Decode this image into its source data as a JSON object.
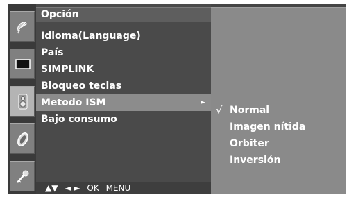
{
  "menu": {
    "title": "Opción",
    "items": [
      {
        "label": "Idioma(Language)",
        "selected": false
      },
      {
        "label": "País",
        "selected": false
      },
      {
        "label": "SIMPLINK",
        "selected": false
      },
      {
        "label": "Bloqueo teclas",
        "selected": false
      },
      {
        "label": "Metodo ISM",
        "selected": true,
        "has_submenu": true
      },
      {
        "label": "Bajo consumo",
        "selected": false
      }
    ],
    "submenu_arrow": "►"
  },
  "submenu": {
    "checkmark": "√",
    "options": [
      {
        "label": "Normal",
        "checked": true
      },
      {
        "label": "Imagen nítida",
        "checked": false
      },
      {
        "label": "Orbiter",
        "checked": false
      },
      {
        "label": "Inversión",
        "checked": false
      }
    ]
  },
  "nav_hint": {
    "arrows_updown": "▲▼",
    "arrows_leftright": "◄ ►",
    "ok": "OK",
    "menu": "MENU"
  },
  "side_icons": [
    {
      "name": "satellite-dish-icon",
      "active": false
    },
    {
      "name": "screen-icon",
      "active": false
    },
    {
      "name": "speaker-icon",
      "active": true
    },
    {
      "name": "clock-icon",
      "active": false
    },
    {
      "name": "key-icon",
      "active": false
    }
  ],
  "colors": {
    "osd_background": "#454545",
    "selected_row": "#8c8c8c",
    "submenu_background": "#8a8a8a",
    "text": "#ffffff"
  }
}
